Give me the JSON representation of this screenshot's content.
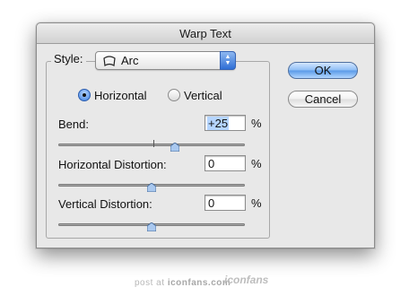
{
  "dialog": {
    "title": "Warp Text"
  },
  "style": {
    "label": "Style:",
    "value": "Arc",
    "icon": "arc-warp-icon"
  },
  "orientation": {
    "horizontal_label": "Horizontal",
    "vertical_label": "Vertical",
    "selected": "horizontal"
  },
  "bend": {
    "label": "Bend:",
    "value": "+25",
    "unit": "%",
    "slider_fraction": 0.625
  },
  "horizontal_distortion": {
    "label": "Horizontal Distortion:",
    "value": "0",
    "unit": "%",
    "slider_fraction": 0.5
  },
  "vertical_distortion": {
    "label": "Vertical Distortion:",
    "value": "0",
    "unit": "%",
    "slider_fraction": 0.5
  },
  "buttons": {
    "ok": "OK",
    "cancel": "Cancel"
  },
  "footer": {
    "prefix": "post at",
    "site": "iconfans.com",
    "logo": "iconfans"
  },
  "colors": {
    "accent": "#5a9ae8",
    "selection": "#b5d5ff"
  }
}
